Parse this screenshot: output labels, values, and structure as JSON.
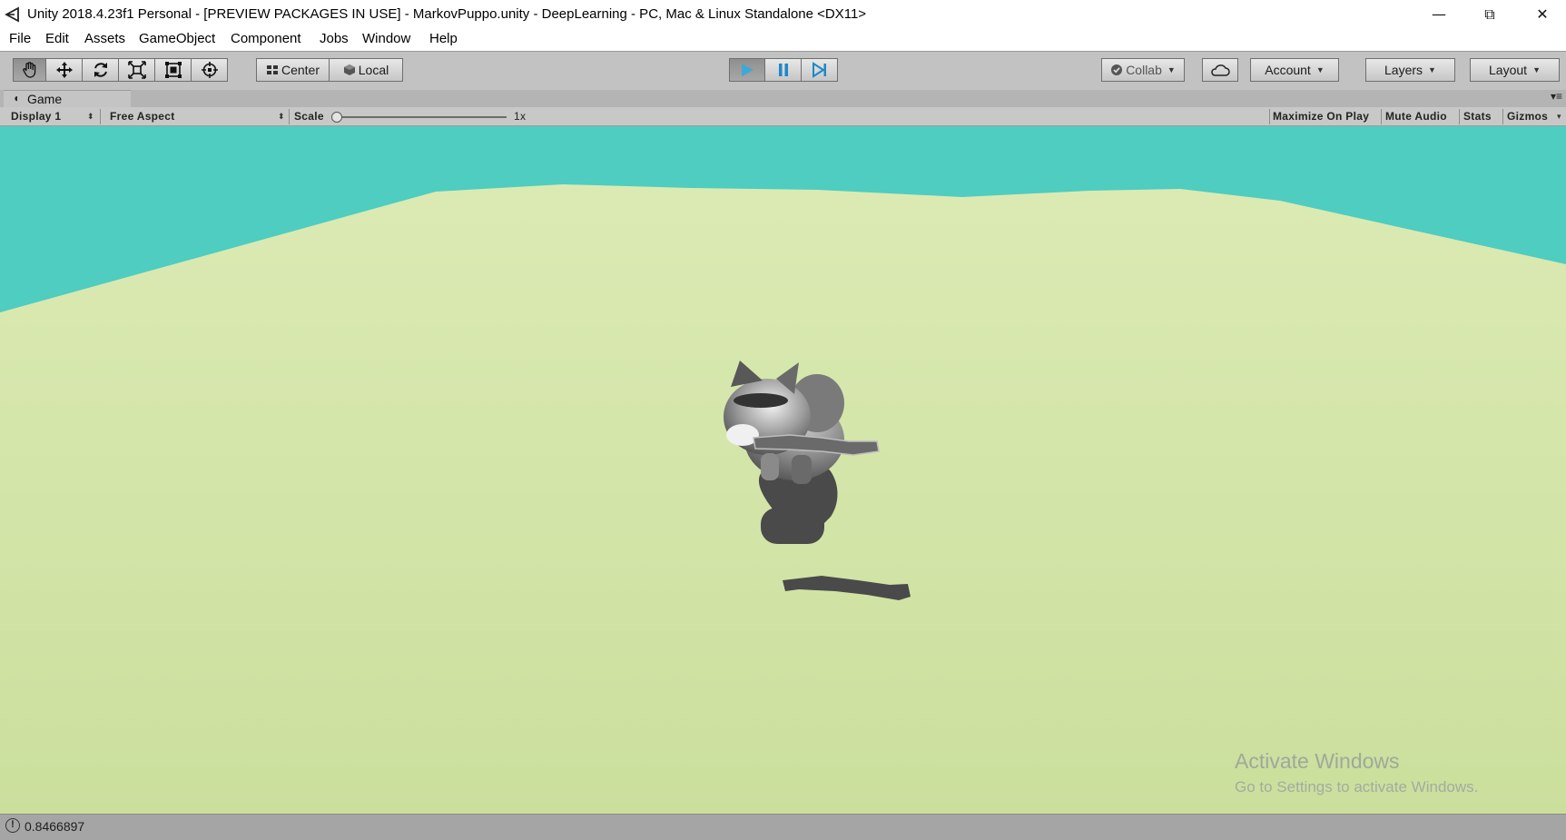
{
  "window": {
    "title": "Unity 2018.4.23f1 Personal - [PREVIEW PACKAGES IN USE] - MarkovPuppo.unity - DeepLearning - PC, Mac & Linux Standalone <DX11>",
    "minimize_glyph": "—",
    "restore_glyph": "⧉",
    "close_glyph": "✕"
  },
  "menu": [
    "File",
    "Edit",
    "Assets",
    "GameObject",
    "Component",
    "Jobs",
    "Window",
    "Help"
  ],
  "toolbar": {
    "tools": [
      "hand-tool-icon",
      "move-tool-icon",
      "rotate-tool-icon",
      "scale-tool-icon",
      "rect-tool-icon",
      "transform-tool-icon"
    ],
    "pivot_center": "Center",
    "pivot_local": "Local",
    "play_state": "playing",
    "collab": "Collab",
    "account": "Account",
    "layers": "Layers",
    "layout": "Layout"
  },
  "game_tab": {
    "label": "Game"
  },
  "game_bar": {
    "display": "Display 1",
    "aspect": "Free Aspect",
    "scale_label": "Scale",
    "scale_value": "1x",
    "maximize_on_play": "Maximize On Play",
    "mute_audio": "Mute Audio",
    "stats": "Stats",
    "gizmos": "Gizmos"
  },
  "scene": {
    "sky_color": "#4ecdc0",
    "ground_color": "#d3e5a6",
    "shadow_color": "#4a4a4a"
  },
  "watermark": {
    "title": "Activate Windows",
    "subtitle": "Go to Settings to activate Windows."
  },
  "status": {
    "message": "0.8466897"
  },
  "colors": {
    "play_active": "#3fa8d8",
    "toolbar_bg": "#c2c2c2"
  }
}
